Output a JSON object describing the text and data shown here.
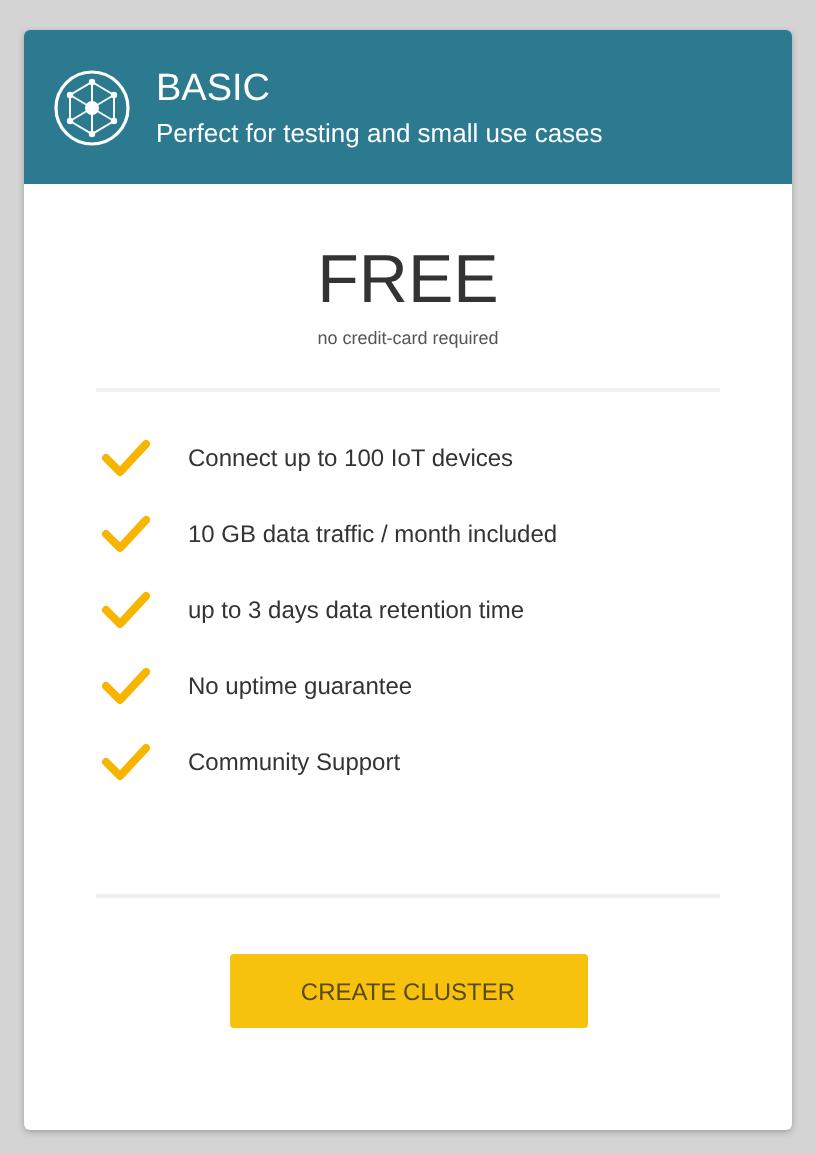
{
  "plan": {
    "title": "BASIC",
    "subtitle": "Perfect for testing and small use cases"
  },
  "price": {
    "amount": "FREE",
    "note": "no credit-card required"
  },
  "features": [
    "Connect up to 100 IoT devices",
    "10 GB data traffic / month included",
    "up to 3 days data retention time",
    "No uptime guarantee",
    "Community Support"
  ],
  "button": "CREATE CLUSTER"
}
